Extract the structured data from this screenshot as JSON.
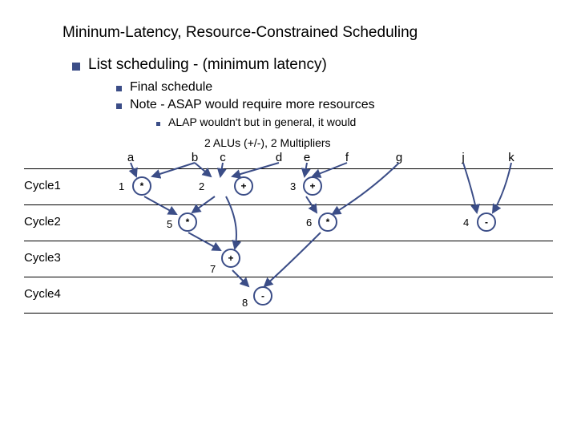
{
  "title": "Mininum-Latency, Resource-Constrained Scheduling",
  "l1": "List scheduling - (minimum latency)",
  "l2a": "Final schedule",
  "l2b": "Note - ASAP would require more resources",
  "l3": "ALAP wouldn't but in general, it would",
  "subtitle": "2 ALUs (+/-), 2 Multipliers",
  "top": {
    "a": "a",
    "b": "b",
    "c": "c",
    "d": "d",
    "e": "e",
    "f": "f",
    "g": "g",
    "j": "j",
    "k": "k"
  },
  "rows": {
    "c1": "Cycle1",
    "c2": "Cycle2",
    "c3": "Cycle3",
    "c4": "Cycle4"
  },
  "nodes": {
    "n1": {
      "num": "1",
      "op": "*"
    },
    "n2": {
      "num": "2",
      "op": "+"
    },
    "n3": {
      "num": "3",
      "op": "+"
    },
    "n4": {
      "num": "4",
      "op": "-"
    },
    "n5": {
      "num": "5",
      "op": "*"
    },
    "n6": {
      "num": "6",
      "op": "*"
    },
    "n7": {
      "num": "7",
      "op": "+"
    },
    "n8": {
      "num": "8",
      "op": "-"
    }
  }
}
